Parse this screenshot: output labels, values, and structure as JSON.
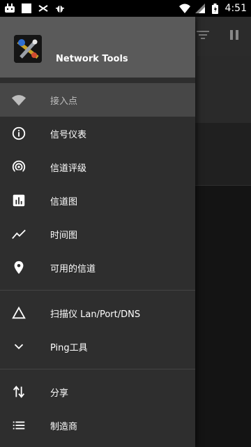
{
  "status_bar": {
    "time": "4:51",
    "left_icons": [
      "android-debug-icon",
      "square-icon",
      "usb-icon",
      "bug-icon"
    ],
    "right_icons": [
      "wifi-icon",
      "signal-icon",
      "battery-icon"
    ]
  },
  "drawer": {
    "app_name": "Network Tools",
    "sections": [
      {
        "items": [
          {
            "id": "access-point",
            "label": "接入点",
            "icon": "wifi-icon",
            "active": true
          },
          {
            "id": "signal-meter",
            "label": "信号仪表",
            "icon": "info-icon",
            "active": false
          },
          {
            "id": "channel-rating",
            "label": "信道评级",
            "icon": "radar-icon",
            "active": false
          },
          {
            "id": "channel-graph",
            "label": "信道图",
            "icon": "bar-chart-icon",
            "active": false
          },
          {
            "id": "time-graph",
            "label": "时间图",
            "icon": "trend-icon",
            "active": false
          },
          {
            "id": "available-channels",
            "label": "可用的信道",
            "icon": "location-pin-icon",
            "active": false
          }
        ]
      },
      {
        "items": [
          {
            "id": "scanner",
            "label": "扫描仪 Lan/Port/DNS",
            "icon": "triangle-icon",
            "active": false
          },
          {
            "id": "ping",
            "label": "Ping工具",
            "icon": "chevron-down-icon",
            "active": false
          }
        ]
      },
      {
        "items": [
          {
            "id": "share",
            "label": "分享",
            "icon": "sort-arrows-icon",
            "active": false
          },
          {
            "id": "vendor",
            "label": "制造商",
            "icon": "list-icon",
            "active": false
          }
        ]
      }
    ]
  },
  "background": {
    "toolbar_icons": [
      "filter-icon",
      "pause-icon"
    ]
  },
  "colors": {
    "drawer_bg": "#2e2e2e",
    "header_bg": "#5a5a5a",
    "active_item_bg": "#474747",
    "status_bar_bg": "#000000"
  }
}
